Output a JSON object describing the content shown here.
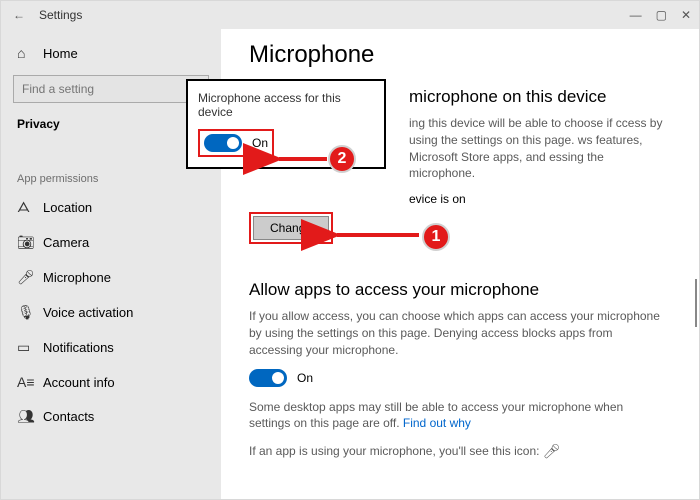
{
  "titlebar": {
    "back": "←",
    "title": "Settings",
    "minimize": "—",
    "maximize": "▢",
    "close": "✕"
  },
  "sidebar": {
    "home_label": "Home",
    "search_placeholder": "Find a setting",
    "category_label": "Privacy",
    "section_label": "App permissions",
    "items": [
      {
        "icon": "ᗋ",
        "label": "Location"
      },
      {
        "icon": "📷︎",
        "label": "Camera"
      },
      {
        "icon": "🎤︎",
        "label": "Microphone"
      },
      {
        "icon": "🎙︎",
        "label": "Voice activation"
      },
      {
        "icon": "▭",
        "label": "Notifications"
      },
      {
        "icon": "A≡",
        "label": "Account info"
      },
      {
        "icon": "👥︎",
        "label": "Contacts"
      }
    ]
  },
  "content": {
    "page_title": "Microphone",
    "section1_title_visible": "microphone on this device",
    "section1_para_visible": "ing this device will be able to choose if ccess by using the settings on this page. ws features, Microsoft Store apps, and essing the microphone.",
    "status_line_visible": "evice is on",
    "change_label": "Change",
    "section2_title": "Allow apps to access your microphone",
    "section2_para": "If you allow access, you can choose which apps can access your microphone by using the settings on this page. Denying access blocks apps from accessing your microphone.",
    "toggle2_label": "On",
    "desktop_apps_para_1": "Some desktop apps may still be able to access your microphone when settings on this page are off. ",
    "find_out_why": "Find out why",
    "current_use_para": "If an app is using your microphone, you'll see this icon: "
  },
  "popup": {
    "title": "Microphone access for this device",
    "toggle_label": "On"
  },
  "annotations": {
    "badge1": "1",
    "badge2": "2"
  }
}
